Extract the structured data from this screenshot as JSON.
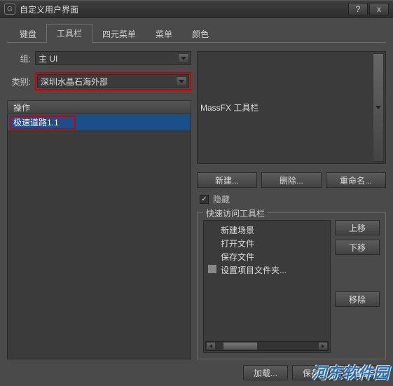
{
  "window": {
    "title": "自定义用户界面"
  },
  "tabs": [
    "键盘",
    "工具栏",
    "四元菜单",
    "菜单",
    "颜色"
  ],
  "left": {
    "group_label": "组:",
    "group_value": "主 UI",
    "category_label": "类别:",
    "category_value": "深圳水晶石海外部",
    "list_header": "操作",
    "list_item": "极速道路1.1"
  },
  "right": {
    "dropdown_value": "MassFX 工具栏",
    "btn_new": "新建...",
    "btn_delete": "删除...",
    "btn_rename": "重命名...",
    "hide_label": "隐藏",
    "fieldset_title": "快速访问工具栏",
    "quick_items": [
      "新建场景",
      "打开文件",
      "保存文件",
      "设置项目文件夹..."
    ],
    "btn_up": "上移",
    "btn_down": "下移",
    "btn_remove": "移除"
  },
  "bottom": {
    "load": "加载...",
    "save": "保存...",
    "reset": "重置"
  },
  "watermark": "河东软件园"
}
